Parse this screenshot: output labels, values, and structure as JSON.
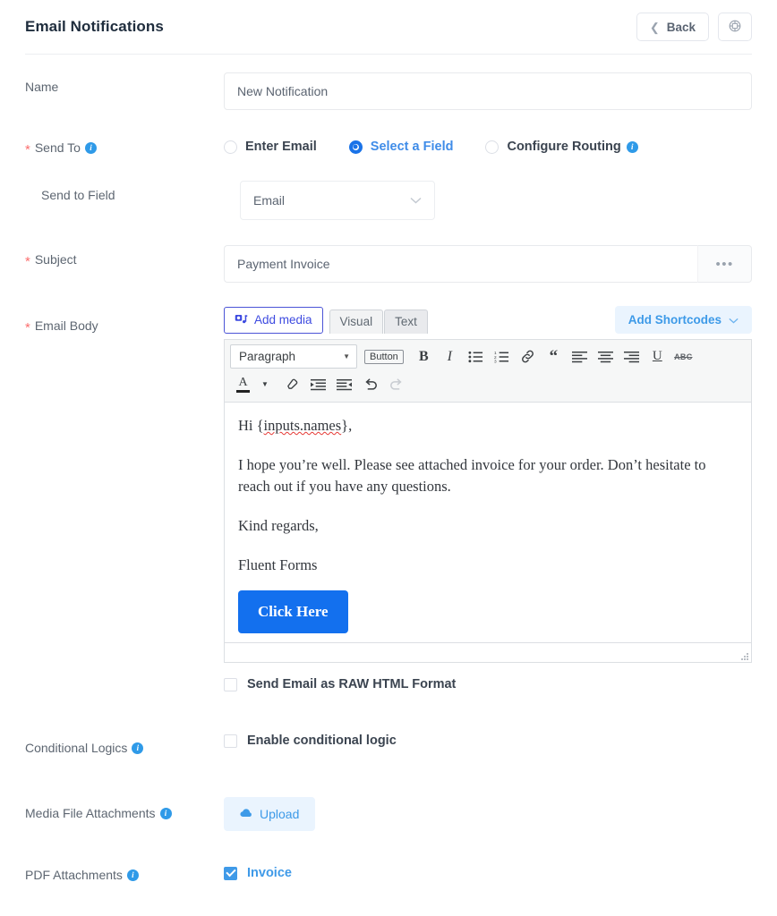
{
  "header": {
    "title": "Email Notifications",
    "back_label": "Back",
    "settings_icon": "settings-circle-icon",
    "back_icon": "chevron-left-icon"
  },
  "fields": {
    "name": {
      "label": "Name",
      "value": "New Notification",
      "placeholder": "New Notification"
    },
    "send_to": {
      "label": "Send To",
      "required": "*",
      "info_icon": "info-icon",
      "options": [
        {
          "label": "Enter Email",
          "selected": false,
          "has_info": false
        },
        {
          "label": "Select a Field",
          "selected": true,
          "has_info": false
        },
        {
          "label": "Configure Routing",
          "selected": false,
          "has_info": true
        }
      ]
    },
    "send_to_field": {
      "label": "Send to Field",
      "value": "Email",
      "chevron": "⌄"
    },
    "subject": {
      "label": "Subject",
      "required": "*",
      "value": "Payment Invoice",
      "more_label": "•••"
    },
    "email_body": {
      "label": "Email Body",
      "required": "*",
      "add_media_label": "Add media",
      "add_media_icon": "media-icon",
      "tabs": [
        {
          "label": "Visual",
          "active": true
        },
        {
          "label": "Text",
          "active": false
        }
      ],
      "add_shortcodes_label": "Add Shortcodes",
      "add_shortcodes_icon": "chevron-down-icon"
    },
    "raw_html": {
      "label": "Send Email as RAW HTML Format",
      "checked": false
    },
    "conditional_logics": {
      "label": "Conditional Logics",
      "checkbox_label": "Enable conditional logic",
      "checked": false
    },
    "media_attachments": {
      "label": "Media File Attachments",
      "upload_label": "Upload",
      "upload_icon": "cloud-upload-icon"
    },
    "pdf_attachments": {
      "label": "PDF Attachments",
      "item_label": "Invoice",
      "checked": true
    }
  },
  "editor": {
    "format_select": "Paragraph",
    "button_chip": "Button",
    "toolbar_row1": [
      {
        "name": "bold-icon",
        "glyph": "B"
      },
      {
        "name": "italic-icon",
        "glyph": "I"
      },
      {
        "name": "bulleted-list-icon",
        "glyph": ""
      },
      {
        "name": "numbered-list-icon",
        "glyph": ""
      },
      {
        "name": "link-icon",
        "glyph": ""
      },
      {
        "name": "blockquote-icon",
        "glyph": "“"
      },
      {
        "name": "align-left-icon",
        "glyph": ""
      },
      {
        "name": "align-center-icon",
        "glyph": ""
      },
      {
        "name": "align-right-icon",
        "glyph": ""
      },
      {
        "name": "underline-icon",
        "glyph": "U"
      },
      {
        "name": "strikethrough-icon",
        "glyph": "ABC"
      }
    ],
    "toolbar_row2": [
      {
        "name": "text-color-icon",
        "glyph": "A"
      },
      {
        "name": "text-color-dropdown-icon",
        "glyph": "▾"
      },
      {
        "name": "clear-formatting-icon",
        "glyph": ""
      },
      {
        "name": "decrease-indent-icon",
        "glyph": ""
      },
      {
        "name": "increase-indent-icon",
        "glyph": ""
      },
      {
        "name": "undo-icon",
        "glyph": ""
      },
      {
        "name": "redo-icon",
        "glyph": ""
      }
    ],
    "content": {
      "greeting_prefix": "Hi {",
      "greeting_token": "inputs.names",
      "greeting_suffix": "},",
      "paragraph": "I hope you’re well. Please see attached invoice for your order. Don’t hesitate to reach out if you have any questions.",
      "closing": "Kind regards,",
      "signature": "Fluent Forms",
      "cta_label": "Click Here"
    }
  },
  "colors": {
    "accent_blue": "#3f9ae8",
    "link_blue": "#1a73e8",
    "cta_blue": "#1370ee",
    "purple_border": "#4b54d6",
    "required_red": "#fb6f6f",
    "label_gray": "#5d6671",
    "title_dark": "#1f2d3d"
  }
}
